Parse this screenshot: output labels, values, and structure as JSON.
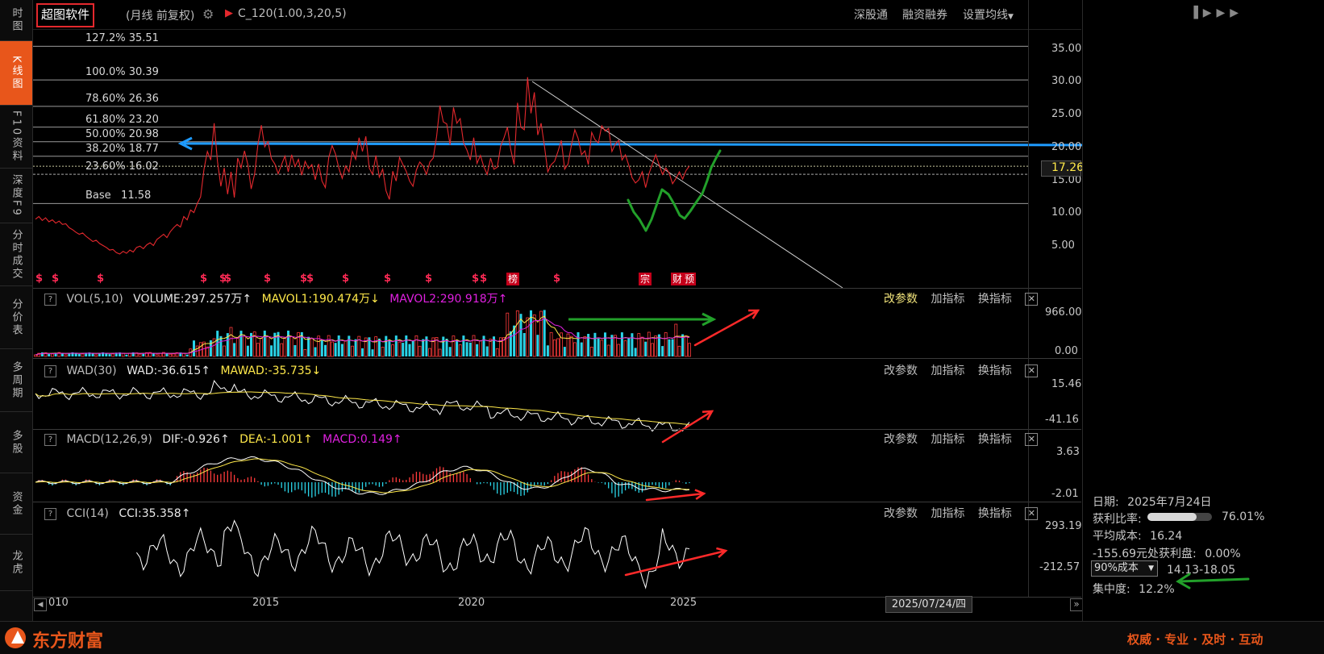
{
  "left_tabs": [
    {
      "label": "时图",
      "active": false
    },
    {
      "label": "K线图",
      "active": true
    },
    {
      "label": "F10资料",
      "active": false
    },
    {
      "label": "深度F9",
      "active": false
    },
    {
      "label": "分时成交",
      "active": false
    },
    {
      "label": "分价表",
      "active": false
    },
    {
      "label": "多周期",
      "active": false
    },
    {
      "label": "多股",
      "active": false
    },
    {
      "label": "资金",
      "active": false
    },
    {
      "label": "龙虎",
      "active": false
    }
  ],
  "header": {
    "title": "超图软件",
    "mode": "(月线 前复权)",
    "indicator": "C_120(1.00,3,20,5)",
    "buttons": [
      "深股通",
      "融资融券",
      "设置均线"
    ]
  },
  "fib_levels": [
    {
      "label": "127.2% 35.51",
      "value": 35.51
    },
    {
      "label": "100.0% 30.39",
      "value": 30.39
    },
    {
      "label": "78.60% 26.36",
      "value": 26.36
    },
    {
      "label": "61.80% 23.20",
      "value": 23.2
    },
    {
      "label": "50.00% 20.98",
      "value": 20.98
    },
    {
      "label": "38.20% 18.77",
      "value": 18.77
    },
    {
      "label": "23.60% 16.02",
      "value": 16.02
    },
    {
      "label": "Base   11.58",
      "value": 11.58
    }
  ],
  "price_axis": [
    "35.00",
    "30.00",
    "25.00",
    "20.00",
    "15.00",
    "10.00",
    "5.00"
  ],
  "current_price": "17.26",
  "markers": {
    "s_glyph": "$",
    "labeled": [
      {
        "text": "榜"
      },
      {
        "text": "宗"
      },
      {
        "text": "财"
      },
      {
        "text": "预"
      }
    ]
  },
  "panels": {
    "vol": {
      "q": "?",
      "name": "VOL(5,10)",
      "v1": "VOLUME:297.257万↑",
      "v2": "MAVOL1:190.474万↓",
      "v3": "MAVOL2:290.918万↑",
      "y_top": "966.00",
      "y_bottom": "0.00"
    },
    "wad": {
      "q": "?",
      "name": "WAD(30)",
      "v1": "WAD:-36.615↑",
      "v2": "MAWAD:-35.735↓",
      "y_top": "15.46",
      "y_bottom": "-41.16"
    },
    "macd": {
      "q": "?",
      "name": "MACD(12,26,9)",
      "v1": "DIF:-0.926↑",
      "v2": "DEA:-1.001↑",
      "v3": "MACD:0.149↑",
      "y_top": "3.63",
      "y_bottom": "-2.01"
    },
    "cci": {
      "q": "?",
      "name": "CCI(14)",
      "v1": "CCI:35.358↑",
      "y_top": "293.19",
      "y_bottom": "-212.57"
    }
  },
  "panel_buttons": {
    "params": "改参数",
    "add": "加指标",
    "swap": "换指标",
    "close": "✕"
  },
  "x_axis": {
    "ticks": [
      "010",
      "2015",
      "2020",
      "2025"
    ],
    "cursor_date": "2025/07/24/四",
    "left_arrow": "◀",
    "right_arrow": "»"
  },
  "right_panel": {
    "date_label": "日期:",
    "date_value": "2025年7月24日",
    "profit_ratio_label": "获利比率:",
    "profit_ratio_value": "76.01%",
    "profit_ratio_fraction": 0.7601,
    "avg_cost_label": "平均成本:",
    "avg_cost_value": "16.24",
    "profit_at_label": "-155.69元处获利盘:",
    "profit_at_value": "0.00%",
    "cost_select": "90%成本",
    "cost_range": "14.13-18.05",
    "concentration_label": "集中度:",
    "concentration_value": "12.2%"
  },
  "brand": {
    "name": "东方财富",
    "slogan": "权威 · 专业 · 及时 · 互动"
  },
  "colors": {
    "brand_orange": "#e8561b",
    "price_line": "#e4282d",
    "blue_line": "#1e9bff",
    "green_annotation": "#22a02a",
    "red_annotation": "#ff2a2a",
    "vol_up": "#ff3b3b",
    "vol_down": "#2ad4e8",
    "mavol1": "#ffe94a",
    "mavol2": "#e020e0",
    "chip_yellow": "#ffff00"
  }
}
